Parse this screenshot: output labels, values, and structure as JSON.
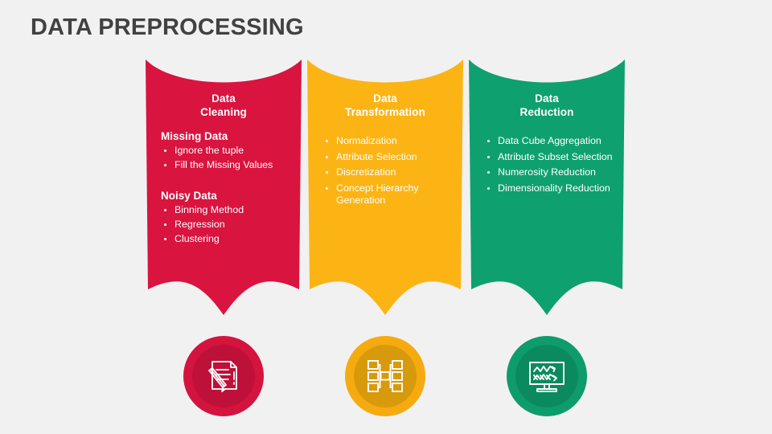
{
  "slide": {
    "title": "DATA PREPROCESSING",
    "background_color": "#f1f1f1",
    "title_color": "#414141"
  },
  "columns": [
    {
      "id": "data-cleaning",
      "heading_line1": "Data",
      "heading_line2": "Cleaning",
      "color": "#d9143f",
      "badge_outer_color": "#d4133f",
      "badge_inner_color": "#bd1139",
      "icon": "document-pencil-icon",
      "blocks": [
        {
          "sub_heading": "Missing Data",
          "items": [
            "Ignore the tuple",
            "Fill the Missing Values"
          ]
        },
        {
          "sub_heading": "Noisy Data",
          "items": [
            "Binning Method",
            "Regression",
            "Clustering"
          ]
        }
      ]
    },
    {
      "id": "data-transformation",
      "heading_line1": "Data",
      "heading_line2": "Transformation",
      "color": "#fcb415",
      "badge_outer_color": "#f5ab10",
      "badge_inner_color": "#d79a0c",
      "icon": "flowchart-icon",
      "blocks": [
        {
          "sub_heading": "",
          "items": [
            "Normalization",
            "Attribute Selection",
            "Discretization",
            "Concept Hierarchy Generation"
          ]
        }
      ]
    },
    {
      "id": "data-reduction",
      "heading_line1": "Data",
      "heading_line2": "Reduction",
      "color": "#0fa070",
      "badge_outer_color": "#0e9c6d",
      "badge_inner_color": "#0b8a60",
      "icon": "monitor-chart-icon",
      "blocks": [
        {
          "sub_heading": "",
          "items": [
            "Data Cube Aggregation",
            "Attribute Subset Selection",
            "Numerosity Reduction",
            "Dimensionality Reduction"
          ]
        }
      ]
    }
  ]
}
